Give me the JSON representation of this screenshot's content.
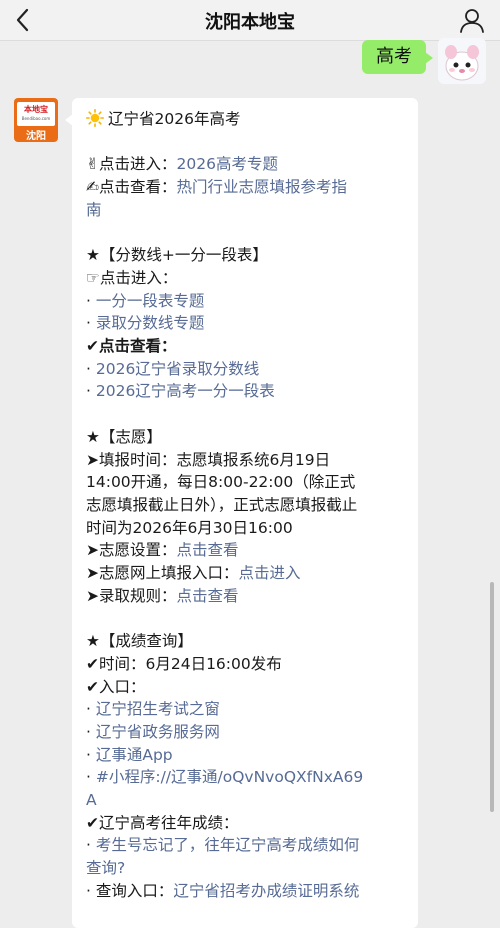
{
  "header": {
    "title": "沈阳本地宝"
  },
  "chat": {
    "user_message": "高考",
    "bot": {
      "avatar_brand": "本地宝",
      "avatar_site": "Bendibao.com",
      "avatar_city": "沈阳"
    }
  },
  "message": {
    "heading": "辽宁省2026年高考",
    "enter_prefix": "✌点击进入：",
    "enter_link": "2026高考专题",
    "view_prefix": "✍点击查看：",
    "view_link_line1": "热门行业志愿填报参考指",
    "view_link_line2": "南",
    "score_heading": "★【分数线+一分一段表】",
    "score_enter_prefix": "☞点击进入：",
    "score_link1_bullet": "· ",
    "score_link1": "一分一段表专题",
    "score_link2_bullet": "· ",
    "score_link2": "录取分数线专题",
    "score_view_prefix": "✔点击查看：",
    "score_link3_bullet": "· ",
    "score_link3": "2026辽宁省录取分数线",
    "score_link4_bullet": "· ",
    "score_link4": "2026辽宁高考一分一段表",
    "wish_heading": "★【志愿】",
    "wish_time_l1": "➤填报时间：志愿填报系统6月19日",
    "wish_time_l2": "14:00开通，每日8:00-22:00（除正式",
    "wish_time_l3": "志愿填报截止日外），正式志愿填报截止",
    "wish_time_l4": "时间为2026年6月30日16:00",
    "wish_setting_prefix": "➤志愿设置：",
    "wish_setting_link": "点击查看",
    "wish_online_prefix": "➤志愿网上填报入口：",
    "wish_online_link": "点击进入",
    "wish_rules_prefix": "➤录取规则：",
    "wish_rules_link": "点击查看",
    "result_heading": "★【成绩查询】",
    "result_time": "✔时间：6月24日16:00发布",
    "result_entry": "✔入口：",
    "result_link1_bullet": "· ",
    "result_link1": "辽宁招生考试之窗",
    "result_link2_bullet": "· ",
    "result_link2": "辽宁省政务服务网",
    "result_link3_bullet": "· ",
    "result_link3": "辽事通App",
    "result_link4_bullet": "· ",
    "result_link4_l1": "#小程序://辽事通/oQvNvoQXfNxA69",
    "result_link4_l2": "A",
    "past_heading": "✔辽宁高考往年成绩：",
    "past_link1_bullet": "· ",
    "past_link1_l1": "考生号忘记了，往年辽宁高考成绩如何",
    "past_link1_l2": "查询?",
    "past_entry_prefix": "· 查询入口：",
    "past_entry_link": "辽宁省招考办成绩证明系统"
  }
}
